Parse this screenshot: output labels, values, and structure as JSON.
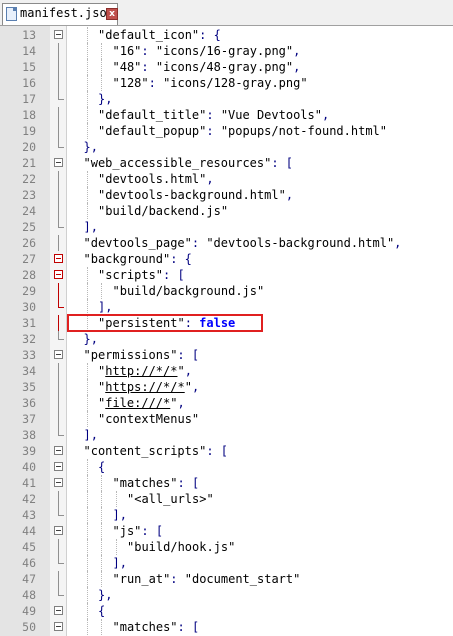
{
  "tab": {
    "title": "manifest.json",
    "icon": "file-icon",
    "close_icon": "close-icon"
  },
  "colors": {
    "highlight": "#e02020",
    "boolean": "#0000ff",
    "punctuation": "#000080",
    "fold_red": "#c00000"
  },
  "lines": [
    {
      "n": "13",
      "indent": 2,
      "fold": "open",
      "toks": [
        [
          "str",
          "\"default_icon\""
        ],
        [
          "punct",
          ": {"
        ]
      ]
    },
    {
      "n": "14",
      "indent": 3,
      "fold": "line",
      "toks": [
        [
          "str",
          "\"16\""
        ],
        [
          "punct",
          ": "
        ],
        [
          "str",
          "\"icons/16-gray.png\""
        ],
        [
          "punct",
          ","
        ]
      ]
    },
    {
      "n": "15",
      "indent": 3,
      "fold": "line",
      "toks": [
        [
          "str",
          "\"48\""
        ],
        [
          "punct",
          ": "
        ],
        [
          "str",
          "\"icons/48-gray.png\""
        ],
        [
          "punct",
          ","
        ]
      ]
    },
    {
      "n": "16",
      "indent": 3,
      "fold": "line",
      "toks": [
        [
          "str",
          "\"128\""
        ],
        [
          "punct",
          ": "
        ],
        [
          "str",
          "\"icons/128-gray.png\""
        ]
      ]
    },
    {
      "n": "17",
      "indent": 2,
      "fold": "end",
      "toks": [
        [
          "punct",
          "},"
        ]
      ]
    },
    {
      "n": "18",
      "indent": 2,
      "fold": "line",
      "toks": [
        [
          "str",
          "\"default_title\""
        ],
        [
          "punct",
          ": "
        ],
        [
          "str",
          "\"Vue Devtools\""
        ],
        [
          "punct",
          ","
        ]
      ]
    },
    {
      "n": "19",
      "indent": 2,
      "fold": "line",
      "toks": [
        [
          "str",
          "\"default_popup\""
        ],
        [
          "punct",
          ": "
        ],
        [
          "str",
          "\"popups/not-found.html\""
        ]
      ]
    },
    {
      "n": "20",
      "indent": 1,
      "fold": "end",
      "toks": [
        [
          "punct",
          "},"
        ]
      ]
    },
    {
      "n": "21",
      "indent": 1,
      "fold": "open",
      "toks": [
        [
          "str",
          "\"web_accessible_resources\""
        ],
        [
          "punct",
          ": ["
        ]
      ]
    },
    {
      "n": "22",
      "indent": 2,
      "fold": "line",
      "toks": [
        [
          "str",
          "\"devtools.html\""
        ],
        [
          "punct",
          ","
        ]
      ]
    },
    {
      "n": "23",
      "indent": 2,
      "fold": "line",
      "toks": [
        [
          "str",
          "\"devtools-background.html\""
        ],
        [
          "punct",
          ","
        ]
      ]
    },
    {
      "n": "24",
      "indent": 2,
      "fold": "line",
      "toks": [
        [
          "str",
          "\"build/backend.js\""
        ]
      ]
    },
    {
      "n": "25",
      "indent": 1,
      "fold": "end",
      "toks": [
        [
          "punct",
          "],"
        ]
      ]
    },
    {
      "n": "26",
      "indent": 1,
      "fold": "line",
      "toks": [
        [
          "str",
          "\"devtools_page\""
        ],
        [
          "punct",
          ": "
        ],
        [
          "str",
          "\"devtools-background.html\""
        ],
        [
          "punct",
          ","
        ]
      ]
    },
    {
      "n": "27",
      "indent": 1,
      "fold": "open-red",
      "toks": [
        [
          "str",
          "\"background\""
        ],
        [
          "punct",
          ": {"
        ]
      ]
    },
    {
      "n": "28",
      "indent": 2,
      "fold": "open-red",
      "toks": [
        [
          "str",
          "\"scripts\""
        ],
        [
          "punct",
          ": ["
        ]
      ]
    },
    {
      "n": "29",
      "indent": 3,
      "fold": "line-red",
      "toks": [
        [
          "str",
          "\"build/background.js\""
        ]
      ]
    },
    {
      "n": "30",
      "indent": 2,
      "fold": "end-red",
      "toks": [
        [
          "punct",
          "],"
        ]
      ]
    },
    {
      "n": "31",
      "indent": 2,
      "fold": "line-red",
      "toks": [
        [
          "str",
          "\"persistent\""
        ],
        [
          "punct",
          ": "
        ],
        [
          "bool",
          "false"
        ]
      ]
    },
    {
      "n": "32",
      "indent": 1,
      "fold": "end",
      "toks": [
        [
          "punct",
          "},"
        ]
      ]
    },
    {
      "n": "33",
      "indent": 1,
      "fold": "open",
      "toks": [
        [
          "str",
          "\"permissions\""
        ],
        [
          "punct",
          ": ["
        ]
      ]
    },
    {
      "n": "34",
      "indent": 2,
      "fold": "line",
      "toks": [
        [
          "str",
          "\""
        ],
        [
          "ul",
          "http://*/*"
        ],
        [
          "str",
          "\""
        ],
        [
          "punct",
          ","
        ]
      ]
    },
    {
      "n": "35",
      "indent": 2,
      "fold": "line",
      "toks": [
        [
          "str",
          "\""
        ],
        [
          "ul",
          "https://*/*"
        ],
        [
          "str",
          "\""
        ],
        [
          "punct",
          ","
        ]
      ]
    },
    {
      "n": "36",
      "indent": 2,
      "fold": "line",
      "toks": [
        [
          "str",
          "\""
        ],
        [
          "ul",
          "file:///*"
        ],
        [
          "str",
          "\""
        ],
        [
          "punct",
          ","
        ]
      ]
    },
    {
      "n": "37",
      "indent": 2,
      "fold": "line",
      "toks": [
        [
          "str",
          "\"contextMenus\""
        ]
      ]
    },
    {
      "n": "38",
      "indent": 1,
      "fold": "end",
      "toks": [
        [
          "punct",
          "],"
        ]
      ]
    },
    {
      "n": "39",
      "indent": 1,
      "fold": "open",
      "toks": [
        [
          "str",
          "\"content_scripts\""
        ],
        [
          "punct",
          ": ["
        ]
      ]
    },
    {
      "n": "40",
      "indent": 2,
      "fold": "open",
      "toks": [
        [
          "punct",
          "{"
        ]
      ]
    },
    {
      "n": "41",
      "indent": 3,
      "fold": "open",
      "toks": [
        [
          "str",
          "\"matches\""
        ],
        [
          "punct",
          ": ["
        ]
      ]
    },
    {
      "n": "42",
      "indent": 4,
      "fold": "line",
      "toks": [
        [
          "str",
          "\"<all_urls>\""
        ]
      ]
    },
    {
      "n": "43",
      "indent": 3,
      "fold": "end",
      "toks": [
        [
          "punct",
          "],"
        ]
      ]
    },
    {
      "n": "44",
      "indent": 3,
      "fold": "open",
      "toks": [
        [
          "str",
          "\"js\""
        ],
        [
          "punct",
          ": ["
        ]
      ]
    },
    {
      "n": "45",
      "indent": 4,
      "fold": "line",
      "toks": [
        [
          "str",
          "\"build/hook.js\""
        ]
      ]
    },
    {
      "n": "46",
      "indent": 3,
      "fold": "end",
      "toks": [
        [
          "punct",
          "],"
        ]
      ]
    },
    {
      "n": "47",
      "indent": 3,
      "fold": "line",
      "toks": [
        [
          "str",
          "\"run_at\""
        ],
        [
          "punct",
          ": "
        ],
        [
          "str",
          "\"document_start\""
        ]
      ]
    },
    {
      "n": "48",
      "indent": 2,
      "fold": "end",
      "toks": [
        [
          "punct",
          "},"
        ]
      ]
    },
    {
      "n": "49",
      "indent": 2,
      "fold": "open",
      "toks": [
        [
          "punct",
          "{"
        ]
      ]
    },
    {
      "n": "50",
      "indent": 3,
      "fold": "open",
      "toks": [
        [
          "str",
          "\"matches\""
        ],
        [
          "punct",
          ": ["
        ]
      ]
    }
  ],
  "highlighted_line": "31"
}
